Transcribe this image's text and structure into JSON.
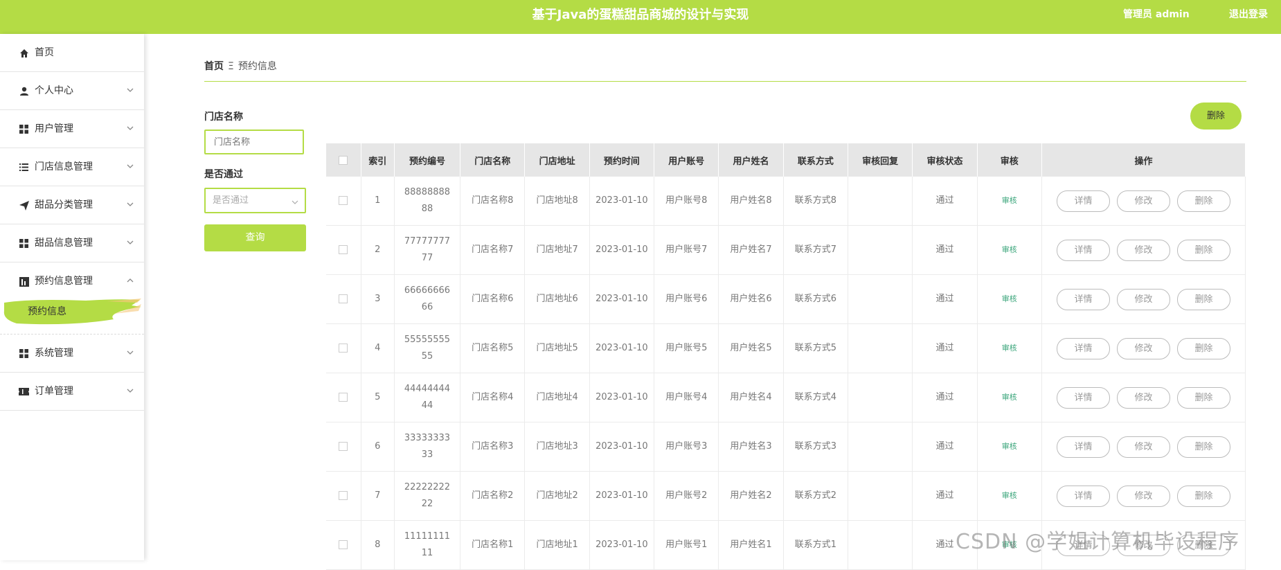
{
  "header": {
    "title": "基于Java的蛋糕甜品商城的设计与实现",
    "admin_label": "管理员 admin",
    "logout_label": "退出登录"
  },
  "sidebar": {
    "items": [
      {
        "label": "首页",
        "icon": "home-icon"
      },
      {
        "label": "个人中心",
        "icon": "user-icon"
      },
      {
        "label": "用户管理",
        "icon": "grid-icon"
      },
      {
        "label": "门店信息管理",
        "icon": "list-icon"
      },
      {
        "label": "甜品分类管理",
        "icon": "send-icon"
      },
      {
        "label": "甜品信息管理",
        "icon": "grid-icon"
      },
      {
        "label": "预约信息管理",
        "icon": "chart-icon"
      },
      {
        "label": "系统管理",
        "icon": "grid-icon"
      },
      {
        "label": "订单管理",
        "icon": "ticket-icon"
      }
    ],
    "submenu": {
      "label": "预约信息"
    }
  },
  "breadcrumb": {
    "home": "首页",
    "separator": "Ξ",
    "current": "预约信息"
  },
  "filters": {
    "store_label": "门店名称",
    "store_placeholder": "门店名称",
    "pass_label": "是否通过",
    "pass_placeholder": "是否通过",
    "query_button": "查询"
  },
  "toolbar": {
    "delete_button": "删除"
  },
  "table": {
    "headers": [
      "",
      "索引",
      "预约编号",
      "门店名称",
      "门店地址",
      "预约时间",
      "用户账号",
      "用户姓名",
      "联系方式",
      "审核回复",
      "审核状态",
      "审核",
      "操作"
    ],
    "rows": [
      {
        "index": "1",
        "code": "8888888888",
        "store": "门店名称8",
        "address": "门店地址8",
        "time": "2023-01-10",
        "account": "用户账号8",
        "name": "用户姓名8",
        "contact": "联系方式8",
        "reply": "",
        "status": "通过",
        "audit": "审核"
      },
      {
        "index": "2",
        "code": "7777777777",
        "store": "门店名称7",
        "address": "门店地址7",
        "time": "2023-01-10",
        "account": "用户账号7",
        "name": "用户姓名7",
        "contact": "联系方式7",
        "reply": "",
        "status": "通过",
        "audit": "审核"
      },
      {
        "index": "3",
        "code": "6666666666",
        "store": "门店名称6",
        "address": "门店地址6",
        "time": "2023-01-10",
        "account": "用户账号6",
        "name": "用户姓名6",
        "contact": "联系方式6",
        "reply": "",
        "status": "通过",
        "audit": "审核"
      },
      {
        "index": "4",
        "code": "5555555555",
        "store": "门店名称5",
        "address": "门店地址5",
        "time": "2023-01-10",
        "account": "用户账号5",
        "name": "用户姓名5",
        "contact": "联系方式5",
        "reply": "",
        "status": "通过",
        "audit": "审核"
      },
      {
        "index": "5",
        "code": "4444444444",
        "store": "门店名称4",
        "address": "门店地址4",
        "time": "2023-01-10",
        "account": "用户账号4",
        "name": "用户姓名4",
        "contact": "联系方式4",
        "reply": "",
        "status": "通过",
        "audit": "审核"
      },
      {
        "index": "6",
        "code": "3333333333",
        "store": "门店名称3",
        "address": "门店地址3",
        "time": "2023-01-10",
        "account": "用户账号3",
        "name": "用户姓名3",
        "contact": "联系方式3",
        "reply": "",
        "status": "通过",
        "audit": "审核"
      },
      {
        "index": "7",
        "code": "2222222222",
        "store": "门店名称2",
        "address": "门店地址2",
        "time": "2023-01-10",
        "account": "用户账号2",
        "name": "用户姓名2",
        "contact": "联系方式2",
        "reply": "",
        "status": "通过",
        "audit": "审核"
      },
      {
        "index": "8",
        "code": "1111111111",
        "store": "门店名称1",
        "address": "门店地址1",
        "time": "2023-01-10",
        "account": "用户账号1",
        "name": "用户姓名1",
        "contact": "联系方式1",
        "reply": "",
        "status": "通过",
        "audit": "审核"
      }
    ],
    "row_actions": {
      "detail": "详情",
      "edit": "修改",
      "delete": "删除"
    }
  },
  "watermark": "CSDN @学姐计算机毕设程序",
  "colors": {
    "accent": "#b4dc45",
    "audit_link": "#3aa57a"
  }
}
